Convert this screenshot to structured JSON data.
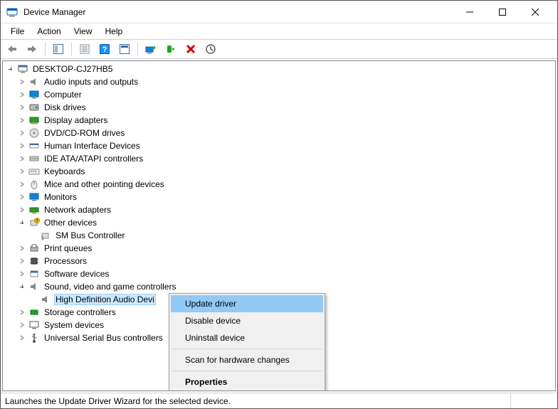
{
  "window": {
    "title": "Device Manager"
  },
  "menu": {
    "file": "File",
    "action": "Action",
    "view": "View",
    "help": "Help"
  },
  "tree": {
    "root": "DESKTOP-CJ27HB5",
    "items": [
      {
        "label": "Audio inputs and outputs",
        "expanded": false
      },
      {
        "label": "Computer",
        "expanded": false
      },
      {
        "label": "Disk drives",
        "expanded": false
      },
      {
        "label": "Display adapters",
        "expanded": false
      },
      {
        "label": "DVD/CD-ROM drives",
        "expanded": false
      },
      {
        "label": "Human Interface Devices",
        "expanded": false
      },
      {
        "label": "IDE ATA/ATAPI controllers",
        "expanded": false
      },
      {
        "label": "Keyboards",
        "expanded": false
      },
      {
        "label": "Mice and other pointing devices",
        "expanded": false
      },
      {
        "label": "Monitors",
        "expanded": false
      },
      {
        "label": "Network adapters",
        "expanded": false
      },
      {
        "label": "Other devices",
        "expanded": true,
        "children": [
          {
            "label": "SM Bus Controller"
          }
        ]
      },
      {
        "label": "Print queues",
        "expanded": false
      },
      {
        "label": "Processors",
        "expanded": false
      },
      {
        "label": "Software devices",
        "expanded": false
      },
      {
        "label": "Sound, video and game controllers",
        "expanded": true,
        "children": [
          {
            "label": "High Definition Audio Devi",
            "selected": true
          }
        ]
      },
      {
        "label": "Storage controllers",
        "expanded": false
      },
      {
        "label": "System devices",
        "expanded": false
      },
      {
        "label": "Universal Serial Bus controllers",
        "expanded": false
      }
    ]
  },
  "contextMenu": {
    "update": "Update driver",
    "disable": "Disable device",
    "uninstall": "Uninstall device",
    "scan": "Scan for hardware changes",
    "properties": "Properties"
  },
  "status": "Launches the Update Driver Wizard for the selected device."
}
